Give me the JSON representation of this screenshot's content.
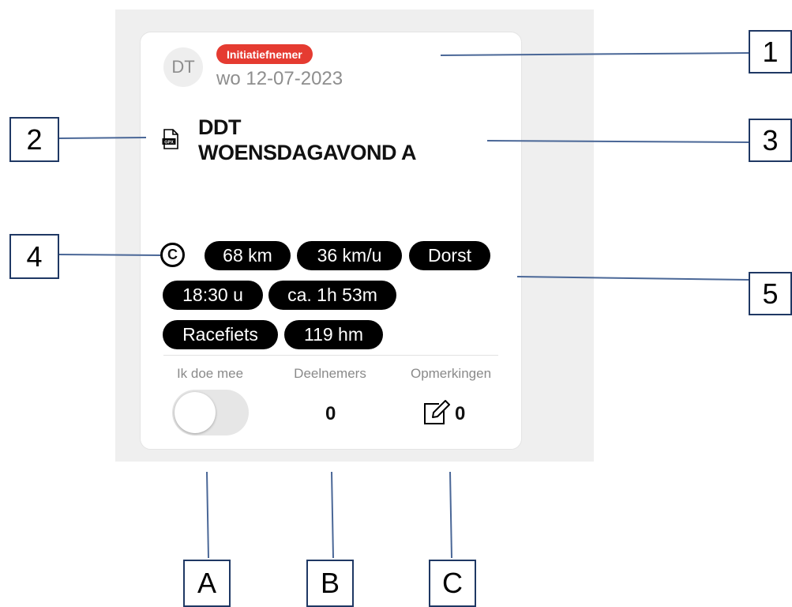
{
  "card": {
    "avatar_initials": "DT",
    "role_badge": "Initiatiefnemer",
    "date": "wo 12-07-2023",
    "gpx_icon_label": "GPX",
    "title_line1": "DDT",
    "title_line2": "WOENSDAGAVOND A",
    "category_letter": "C",
    "tags": {
      "distance": "68 km",
      "speed": "36 km/u",
      "location": "Dorst",
      "start_time": "18:30 u",
      "duration": "ca. 1h 53m",
      "bike_type": "Racefiets",
      "elevation": "119 hm"
    },
    "join_label": "Ik doe mee",
    "join_toggle_on": false,
    "participants_label": "Deelnemers",
    "participants_count": "0",
    "comments_label": "Opmerkingen",
    "comments_count": "0"
  },
  "callouts": {
    "c1": "1",
    "c2": "2",
    "c3": "3",
    "c4": "4",
    "c5": "5",
    "cA": "A",
    "cB": "B",
    "cC": "C"
  },
  "colors": {
    "badge": "#e53b31",
    "panel_bg": "#efefef",
    "callout_line": "#4a6797",
    "callout_border": "#1f3864"
  }
}
